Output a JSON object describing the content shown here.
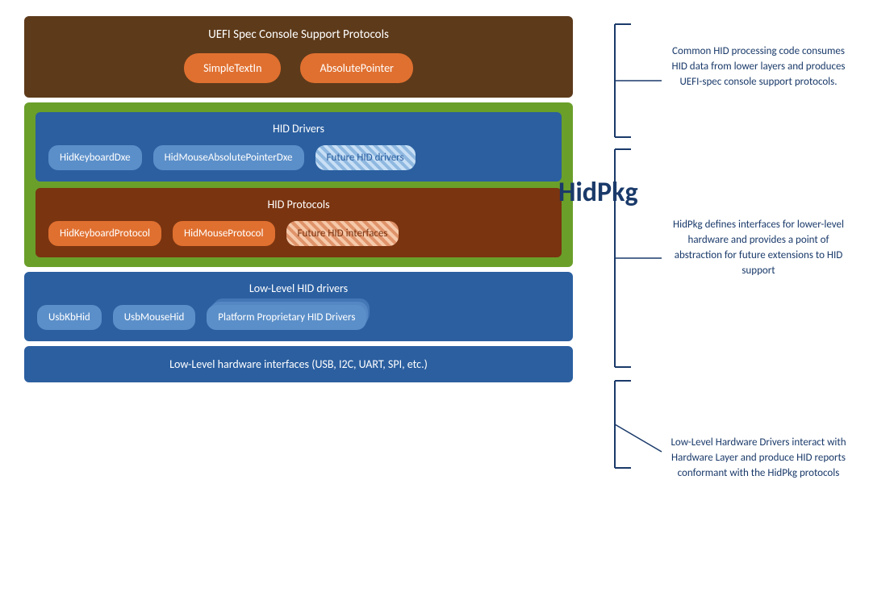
{
  "uefi": {
    "title": "UEFI Spec Console Support Protocols",
    "chips": [
      "SimpleTextIn",
      "AbsolutePointer"
    ]
  },
  "hidpkg_label": "HidPkg",
  "hid_drivers": {
    "title": "HID Drivers",
    "chips": [
      "HidKeyboardDxe",
      "HidMouseAbsolutePointerDxe"
    ],
    "future_chip": "Future HID drivers"
  },
  "hid_protocols": {
    "title": "HID Protocols",
    "chips": [
      "HidKeyboardProtocol",
      "HidMouseProtocol"
    ],
    "future_chip": "Future HID interfaces"
  },
  "low_level": {
    "title": "Low-Level HID drivers",
    "chips": [
      "UsbKbHid",
      "UsbMouseHid"
    ],
    "stack_chip": "Platform Proprietary HID Drivers"
  },
  "hw_interfaces": {
    "label": "Low-Level hardware interfaces (USB, I2C, UART, SPI, etc.)"
  },
  "annotations": {
    "top": "Common HID processing code consumes HID data from lower layers and produces UEFI-spec console support protocols.",
    "middle": "HidPkg defines interfaces for lower-level hardware and provides a point of abstraction for future extensions to HID support",
    "bottom": "Low-Level Hardware Drivers interact with Hardware Layer and produce HID reports conformant with the HidPkg protocols"
  }
}
